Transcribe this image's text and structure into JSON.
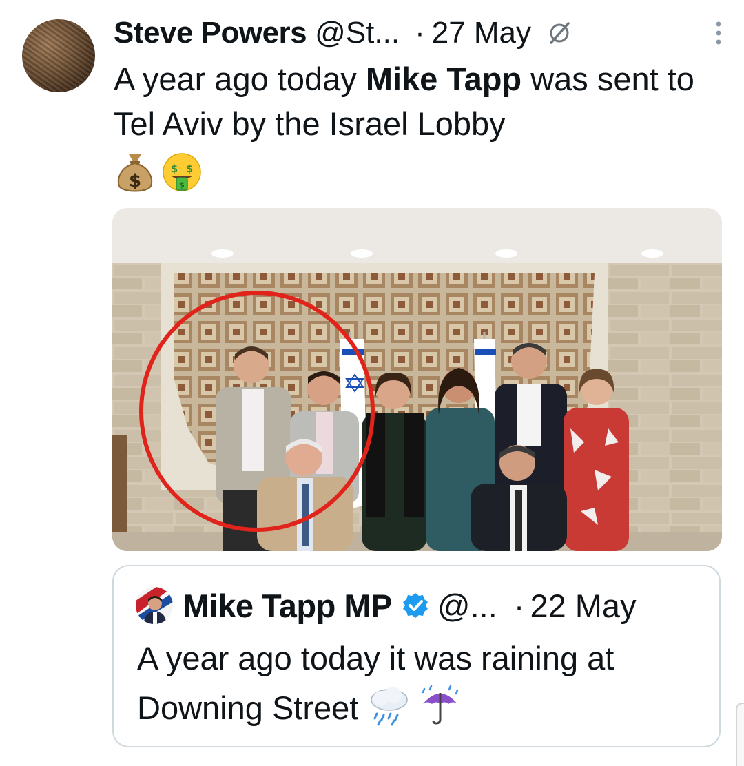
{
  "tweet": {
    "author_name": "Steve Powers",
    "author_handle": "@St...",
    "separator": "·",
    "date": "27 May",
    "text_part1": "A year ago today ",
    "text_bold": "Mike Tapp",
    "text_part2": " was sent to Tel Aviv by the Israel Lobby",
    "emojis": [
      "money-bag",
      "money-mouth-face"
    ],
    "icons": {
      "status": "grok-slash-icon",
      "more": "more-vertical-icon"
    }
  },
  "photo": {
    "description_hidden": ""
  },
  "quoted_tweet": {
    "author_name": "Mike Tapp MP",
    "author_handle": "@...",
    "separator": "·",
    "date": "22 May",
    "text": "A year ago today it was raining at Downing Street",
    "emojis": [
      "cloud-with-rain",
      "umbrella-with-rain"
    ],
    "verified_color": "#1d9bf0"
  },
  "colors": {
    "text": "#0f1419",
    "border": "#cfd9de",
    "highlight_circle": "#e0241b"
  }
}
